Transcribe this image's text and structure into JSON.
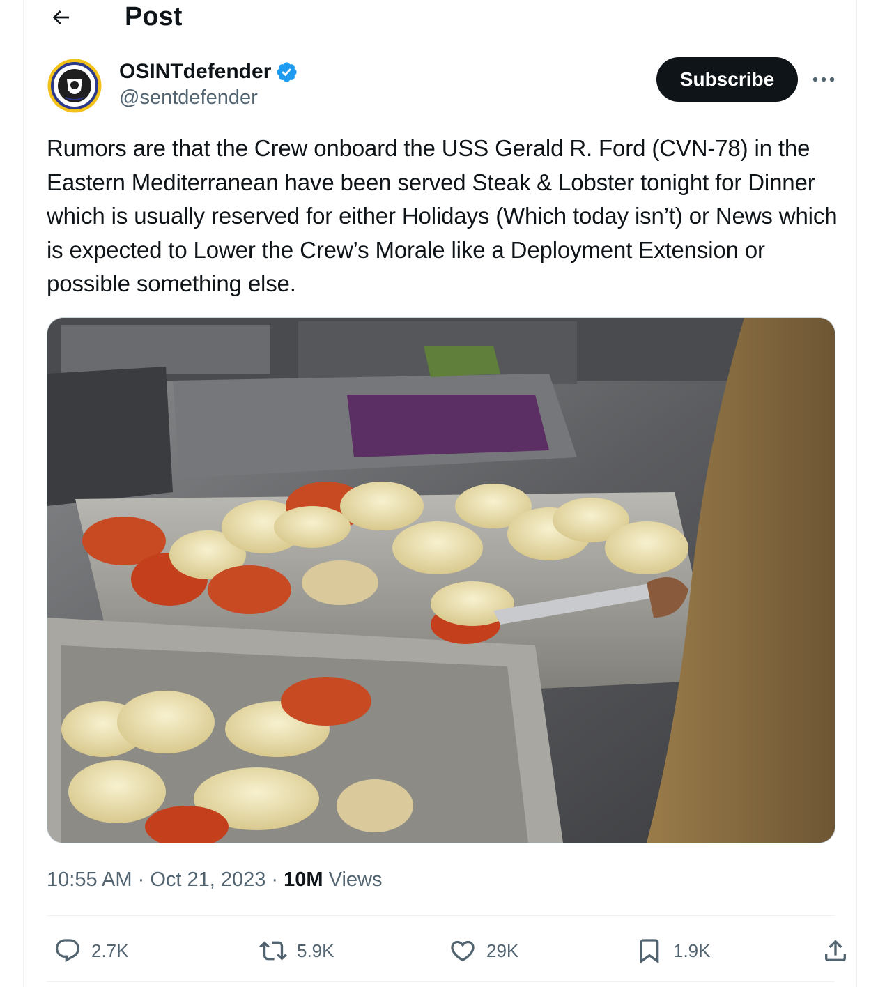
{
  "header": {
    "title": "Post",
    "back_icon": "arrow-left-icon"
  },
  "author": {
    "display_name": "OSINTdefender",
    "handle": "@sentdefender",
    "verified_icon": "verified-badge-icon",
    "avatar_icon": "osint-seal-avatar"
  },
  "actions_top": {
    "subscribe_label": "Subscribe",
    "more_icon": "more-dots-icon"
  },
  "post": {
    "text": "Rumors are that the Crew onboard the USS Gerald R. Ford (CVN-78) in the Eastern Mediterranean have been served Steak & Lobster tonight for Dinner which is usually reserved for either Holidays (Which today isn’t) or News which is expected to Lower the Crew’s Morale like a Deployment Extension or possible something else.",
    "media_icon": "lobster-tails-photo",
    "time": "10:55 AM",
    "separator": " · ",
    "date": "Oct 21, 2023",
    "views_count": "10M",
    "views_label": "Views"
  },
  "engagement": {
    "replies": "2.7K",
    "reposts": "5.9K",
    "likes": "29K",
    "bookmarks": "1.9K"
  },
  "colors": {
    "text": "#0f1419",
    "secondary": "#536471",
    "verified": "#1d9bf0",
    "button": "#0f1419",
    "divider": "#eff3f4"
  }
}
